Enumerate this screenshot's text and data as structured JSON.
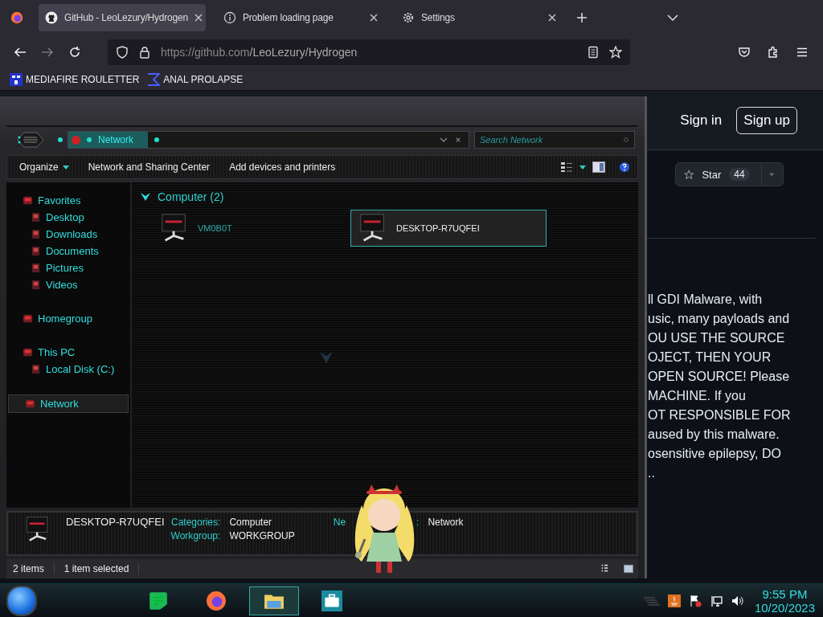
{
  "browser": {
    "tabs": [
      {
        "kind": "github",
        "title": "GitHub - LeoLezury/Hydrogen",
        "selected": true
      },
      {
        "kind": "info",
        "title": "Problem loading page",
        "selected": false
      },
      {
        "kind": "gear",
        "title": "Settings",
        "selected": false
      }
    ],
    "url_host": "https://github.com",
    "url_path": "/LeoLezury/Hydrogen",
    "bookmarks": [
      {
        "kind": "mf",
        "label": "MEDIAFIRE ROULETTER"
      },
      {
        "kind": "sigma",
        "label": "ANAL PROLAPSE"
      }
    ]
  },
  "github": {
    "sign_in": "Sign in",
    "sign_up": "Sign up",
    "star_label": "Star",
    "star_count": "44",
    "description_lines": [
      "ll GDI Malware, with",
      "usic, many payloads and",
      "OU USE THE SOURCE",
      "OJECT, THEN YOUR",
      "OPEN SOURCE! Please",
      "MACHINE. If you",
      "OT RESPONSIBLE FOR",
      "aused by this malware.",
      "osensitive epilepsy, DO",
      ".."
    ]
  },
  "explorer": {
    "address": "Network",
    "search_placeholder": "Search Network",
    "toolbar": [
      {
        "kind": "menu",
        "label": "Organize"
      },
      {
        "kind": "button",
        "label": "Network and Sharing Center"
      },
      {
        "kind": "button",
        "label": "Add devices and printers"
      }
    ],
    "nav": [
      {
        "label": "Favorites",
        "selected": false,
        "children": [
          {
            "label": "Desktop",
            "selected": false
          },
          {
            "label": "Downloads",
            "selected": false
          },
          {
            "label": "Documents",
            "selected": false
          },
          {
            "label": "Pictures",
            "selected": false
          },
          {
            "label": "Videos",
            "selected": false
          }
        ]
      },
      {
        "label": "Homegroup",
        "selected": false
      },
      {
        "label": "This PC",
        "selected": false,
        "children": [
          {
            "label": "Local Disk (C:)",
            "selected": false
          }
        ]
      },
      {
        "label": "Network",
        "selected": true
      }
    ],
    "group_header": "Computer (2)",
    "items": [
      {
        "name": "VM0B0T",
        "selected": false
      },
      {
        "name": "DESKTOP-R7UQFEI",
        "selected": true
      }
    ],
    "details": {
      "name": "DESKTOP-R7UQFEI",
      "rows": [
        {
          "label": "Categories:",
          "value": "Computer"
        },
        {
          "label": "Workgroup:",
          "value": "WORKGROUP"
        }
      ],
      "third_label_start": "Ne",
      "third_label_end": ":",
      "third_value": "Network"
    },
    "status": {
      "count": "2 items",
      "selection": "1 item selected"
    }
  },
  "taskbar": {
    "apps": [
      {
        "kind": "notes",
        "active": false
      },
      {
        "kind": "firefox",
        "active": false
      },
      {
        "kind": "explorer",
        "active": true
      },
      {
        "kind": "briefcase",
        "active": false
      }
    ],
    "time": "9:55 PM",
    "date": "10/20/2023"
  }
}
